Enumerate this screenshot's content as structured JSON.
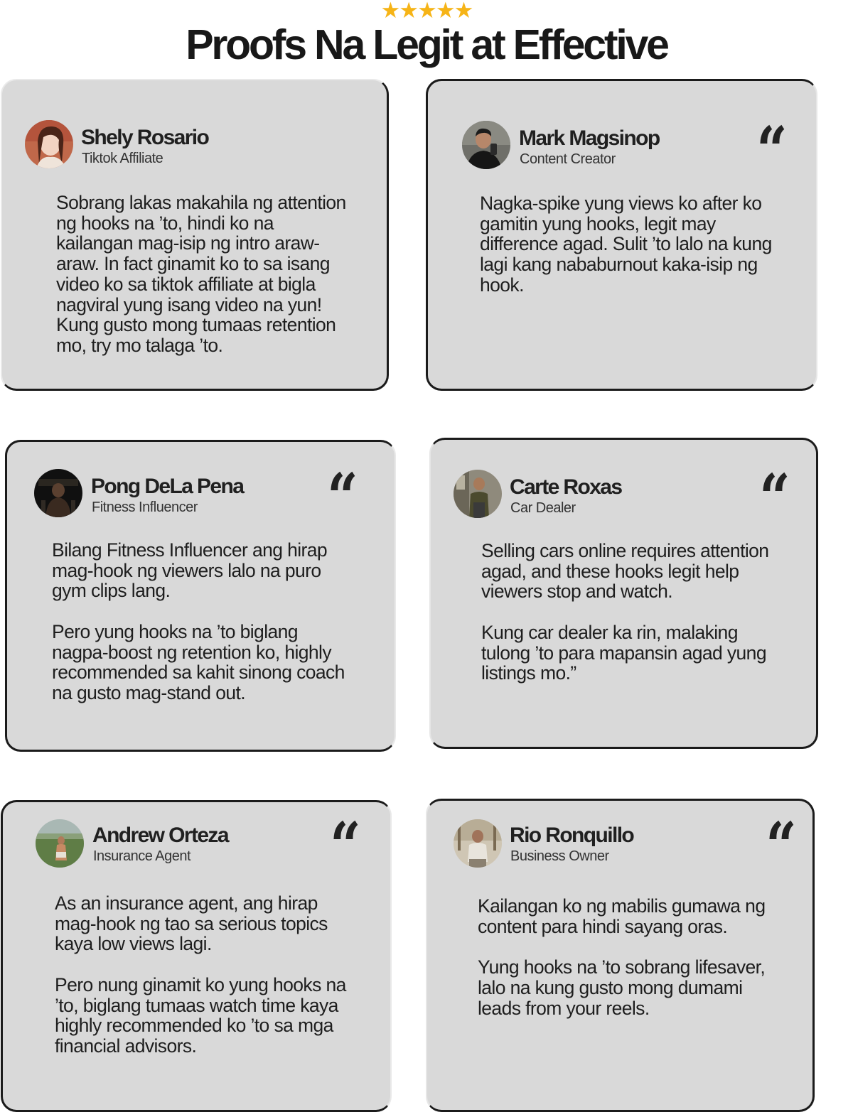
{
  "header": {
    "stars": "★★★★★",
    "title": "Proofs Na Legit at Effective"
  },
  "colors": {
    "star": "#f6b417",
    "card_bg": "#d9d9d9",
    "card_border": "#1b1b1b",
    "heading": "#181818"
  },
  "quote_mark": "“",
  "testimonials": [
    {
      "name": "Shely Rosario",
      "role": "Tiktok Affiliate",
      "paragraphs": [
        "Sobrang lakas makahila ng attention ng hooks na ’to, hindi ko na kailangan mag-isip ng intro araw-araw. In fact ginamit ko to sa isang video ko sa tiktok affiliate at bigla nagviral yung isang video na yun! Kung gusto mong tumaas retention mo, try mo talaga ’to."
      ]
    },
    {
      "name": "Mark Magsinop",
      "role": "Content Creator",
      "paragraphs": [
        "Nagka-spike yung views ko after ko gamitin yung hooks, legit may difference agad.  Sulit ’to lalo na kung lagi kang nababurnout kaka-isip ng hook."
      ]
    },
    {
      "name": "Pong DeLa Pena",
      "role": "Fitness Influencer",
      "paragraphs": [
        "Bilang Fitness Influencer ang hirap mag-hook ng viewers lalo na puro gym clips lang.",
        "Pero yung hooks na ’to biglang nagpa-boost ng retention ko, highly recommended sa kahit sinong coach na gusto mag-stand out."
      ]
    },
    {
      "name": "Carte Roxas",
      "role": "Car Dealer",
      "paragraphs": [
        "Selling cars online requires attention agad, and these hooks legit help viewers stop and watch.",
        "Kung car dealer ka rin, malaking tulong ’to para mapansin agad yung listings mo.”"
      ]
    },
    {
      "name": "Andrew Orteza",
      "role": "Insurance Agent",
      "paragraphs": [
        "As an insurance agent, ang hirap mag-hook ng tao sa serious topics kaya low views lagi.",
        "Pero nung ginamit ko yung hooks na ’to, biglang tumaas watch time kaya highly recommended ko ’to sa mga financial advisors."
      ]
    },
    {
      "name": "Rio Ronquillo",
      "role": "Business Owner",
      "paragraphs": [
        "Kailangan ko ng mabilis gumawa ng content para hindi sayang oras.",
        "Yung hooks na ’to sobrang lifesaver, lalo na kung gusto mong dumami leads from your reels."
      ]
    }
  ]
}
